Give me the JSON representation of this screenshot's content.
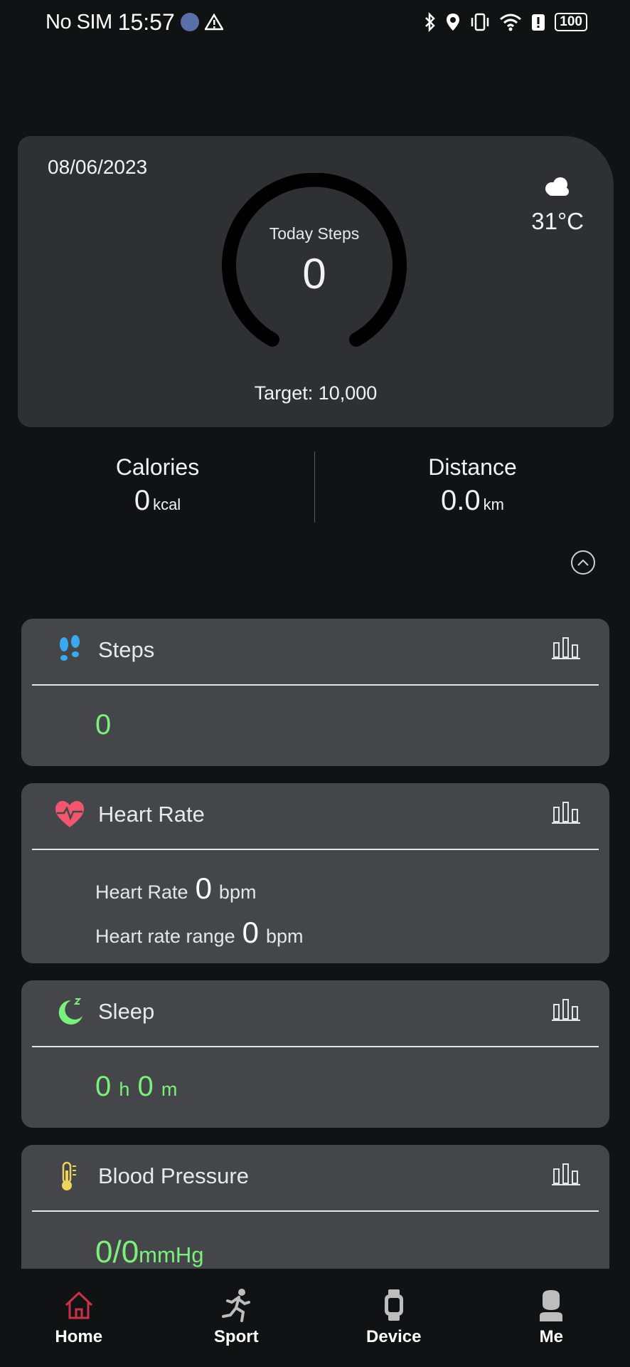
{
  "status_bar": {
    "carrier": "No SIM",
    "time": "15:57",
    "battery": "100"
  },
  "hero": {
    "date": "08/06/2023",
    "temperature": "31°C",
    "weather_icon": "cloud-icon",
    "ring_label": "Today Steps",
    "ring_value": "0",
    "target": "Target: 10,000"
  },
  "stats": {
    "calories_label": "Calories",
    "calories_value": "0",
    "calories_unit": "kcal",
    "distance_label": "Distance",
    "distance_value": "0.0",
    "distance_unit": "km"
  },
  "cards": {
    "steps": {
      "title": "Steps",
      "value": "0"
    },
    "heart_rate": {
      "title": "Heart Rate",
      "hr_label": "Heart Rate",
      "hr_value": "0",
      "hr_unit": "bpm",
      "range_label": "Heart rate range",
      "range_value": "0",
      "range_unit": "bpm"
    },
    "sleep": {
      "title": "Sleep",
      "hours": "0",
      "h_unit": "h",
      "minutes": "0",
      "m_unit": "m"
    },
    "blood_pressure": {
      "title": "Blood Pressure",
      "value": "0/0",
      "unit": "mmHg"
    }
  },
  "nav": {
    "home": "Home",
    "sport": "Sport",
    "device": "Device",
    "me": "Me"
  },
  "colors": {
    "accent_green": "#7cf07c",
    "heart_pink": "#f2566e",
    "steps_blue": "#3aa9f0",
    "thermo_yellow": "#f0d35a",
    "home_active": "#c9334a"
  }
}
